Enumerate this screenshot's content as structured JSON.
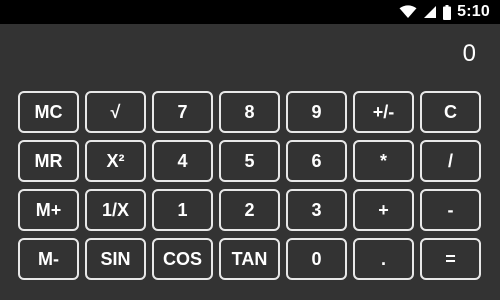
{
  "status_bar": {
    "time": "5:10",
    "icons": [
      "wifi-icon",
      "cellular-signal-icon",
      "battery-icon"
    ]
  },
  "display": {
    "value": "0"
  },
  "keys": {
    "mc": "MC",
    "sqrt": "√",
    "seven": "7",
    "eight": "8",
    "nine": "9",
    "plus_minus": "+/-",
    "clear": "C",
    "mr": "MR",
    "square": "X²",
    "four": "4",
    "five": "5",
    "six": "6",
    "multiply": "*",
    "divide": "/",
    "m_plus": "M+",
    "reciprocal": "1/X",
    "one": "1",
    "two": "2",
    "three": "3",
    "add": "+",
    "subtract": "-",
    "m_minus": "M-",
    "sin": "SIN",
    "cos": "COS",
    "tan": "TAN",
    "zero": "0",
    "decimal": ".",
    "equals": "="
  },
  "colors": {
    "background": "#333333",
    "status_bar": "#000000",
    "key_border": "#e8e8e8",
    "text": "#ffffff"
  }
}
